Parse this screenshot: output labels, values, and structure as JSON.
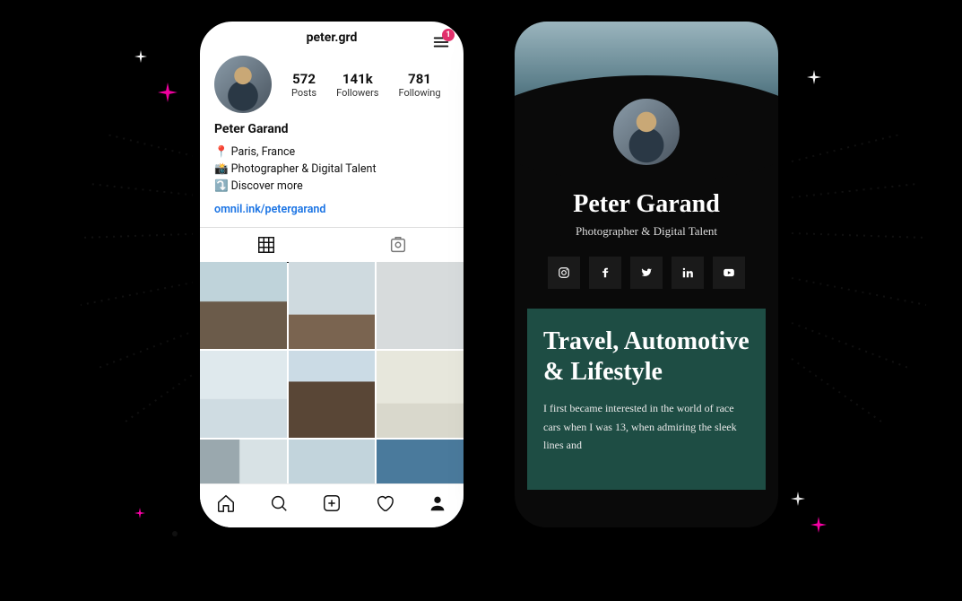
{
  "instagram": {
    "username": "peter.grd",
    "notification_count": "1",
    "stats": {
      "posts": {
        "num": "572",
        "label": "Posts"
      },
      "followers": {
        "num": "141k",
        "label": "Followers"
      },
      "following": {
        "num": "781",
        "label": "Following"
      }
    },
    "bio": {
      "name": "Peter Garand",
      "line1": "📍 Paris, France",
      "line2": "📸 Photographer & Digital Talent",
      "line3": "⤵️ Discover more",
      "link": "omnil.ink/petergarand"
    }
  },
  "profile": {
    "name": "Peter Garand",
    "subtitle": "Photographer & Digital Talent",
    "card_title": "Travel, Automotive & Lifestyle",
    "card_body": "I first became interested in the world of race cars when I was 13, when admiring the sleek lines and"
  },
  "colors": {
    "accent_pink": "#ff00aa",
    "card_green": "#1e4d44",
    "link_blue": "#1b74e4",
    "badge_red": "#e1306c"
  }
}
